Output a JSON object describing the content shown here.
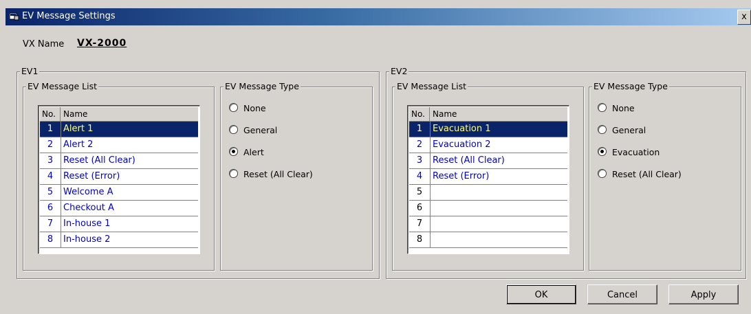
{
  "window": {
    "title": "EV Message Settings",
    "close_glyph": "x"
  },
  "vx": {
    "label": "VX Name",
    "value": "VX-2000"
  },
  "ev1": {
    "title": "EV1",
    "list_title": "EV Message List",
    "type_title": "EV Message Type",
    "columns": {
      "no": "No.",
      "name": "Name"
    },
    "rows": [
      {
        "no": "1",
        "name": "Alert 1"
      },
      {
        "no": "2",
        "name": "Alert 2"
      },
      {
        "no": "3",
        "name": "Reset (All Clear)"
      },
      {
        "no": "4",
        "name": "Reset (Error)"
      },
      {
        "no": "5",
        "name": "Welcome A"
      },
      {
        "no": "6",
        "name": "Checkout A"
      },
      {
        "no": "7",
        "name": "In-house 1"
      },
      {
        "no": "8",
        "name": "In-house 2"
      }
    ],
    "selected_row": "1",
    "types": [
      {
        "label": "None",
        "checked": false
      },
      {
        "label": "General",
        "checked": false
      },
      {
        "label": "Alert",
        "checked": true
      },
      {
        "label": "Reset (All Clear)",
        "checked": false
      }
    ]
  },
  "ev2": {
    "title": "EV2",
    "list_title": "EV Message List",
    "type_title": "EV Message Type",
    "columns": {
      "no": "No.",
      "name": "Name"
    },
    "rows": [
      {
        "no": "1",
        "name": "Evacuation 1"
      },
      {
        "no": "2",
        "name": "Evacuation 2"
      },
      {
        "no": "3",
        "name": "Reset (All Clear)"
      },
      {
        "no": "4",
        "name": "Reset (Error)"
      },
      {
        "no": "5",
        "name": ""
      },
      {
        "no": "6",
        "name": ""
      },
      {
        "no": "7",
        "name": ""
      },
      {
        "no": "8",
        "name": ""
      }
    ],
    "selected_row": "1",
    "types": [
      {
        "label": "None",
        "checked": false
      },
      {
        "label": "General",
        "checked": false
      },
      {
        "label": "Evacuation",
        "checked": true
      },
      {
        "label": "Reset (All Clear)",
        "checked": false
      }
    ]
  },
  "buttons": {
    "ok": "OK",
    "cancel": "Cancel",
    "apply": "Apply"
  },
  "colors": {
    "selection_bg": "#0a246a",
    "selection_text": "#ffff80",
    "list_text": "#0000cc",
    "face": "#d6d3ce"
  }
}
